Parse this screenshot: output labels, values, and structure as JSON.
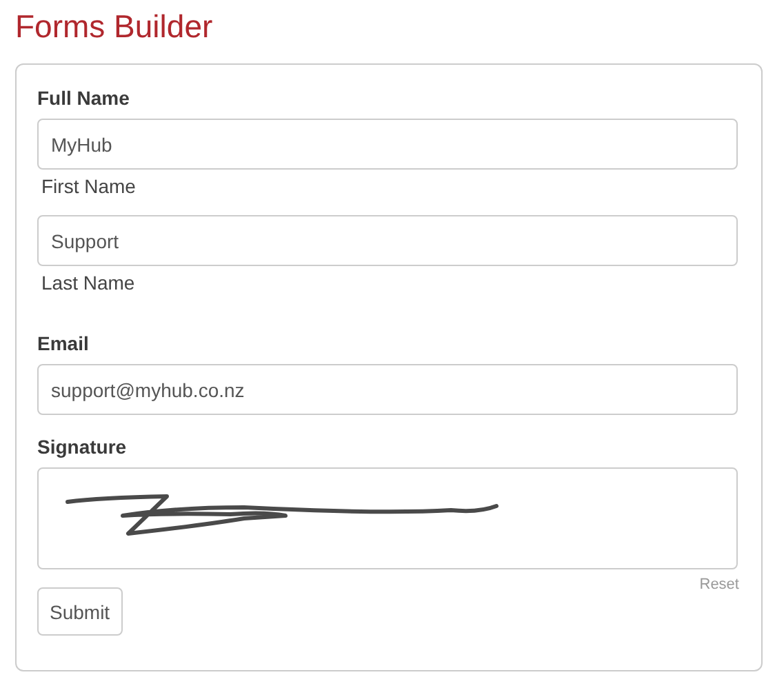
{
  "title": "Forms Builder",
  "fields": [
    {
      "kind": "name",
      "label": "Full Name",
      "parts": [
        {
          "value": "MyHub",
          "sublabel": "First Name"
        },
        {
          "value": "Support",
          "sublabel": "Last Name"
        }
      ]
    },
    {
      "kind": "text",
      "label": "Email",
      "value": "support@myhub.co.nz"
    },
    {
      "kind": "signature",
      "label": "Signature",
      "reset": "Reset"
    }
  ],
  "submit": "Submit"
}
